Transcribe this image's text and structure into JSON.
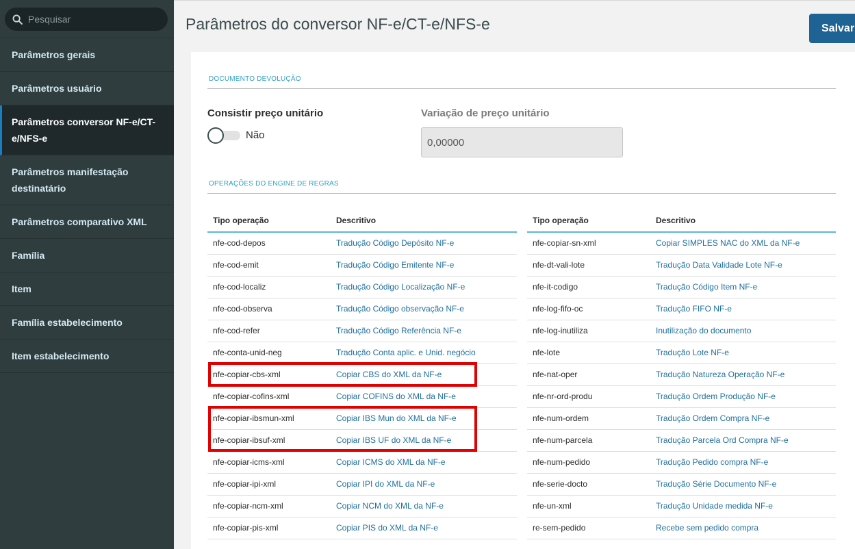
{
  "search": {
    "placeholder": "Pesquisar"
  },
  "sidebar": {
    "items": [
      {
        "label": "Parâmetros gerais"
      },
      {
        "label": "Parâmetros usuário"
      },
      {
        "label": "Parâmetros conversor NF-e/CT-e/NFS-e"
      },
      {
        "label": "Parâmetros manifestação destinatário"
      },
      {
        "label": "Parâmetros comparativo XML"
      },
      {
        "label": "Família"
      },
      {
        "label": "Item"
      },
      {
        "label": "Família estabelecimento"
      },
      {
        "label": "Item estabelecimento"
      }
    ]
  },
  "header": {
    "title": "Parâmetros do conversor NF-e/CT-e/NFS-e",
    "save_label": "Salvar"
  },
  "document_return": {
    "section_title": "DOCUMENTO DEVOLUÇÃO",
    "check_price_label": "Consistir preço unitário",
    "toggle_value": "Não",
    "price_variation_label": "Variação de preço unitário",
    "price_variation_value": "0,00000"
  },
  "operations": {
    "section_title": "OPERAÇÕES DO ENGINE DE REGRAS",
    "headers": {
      "type": "Tipo operação",
      "description": "Descritivo"
    },
    "left_rows": [
      {
        "type": "nfe-cod-depos",
        "description": "Tradução Código Depósito NF-e"
      },
      {
        "type": "nfe-cod-emit",
        "description": "Tradução Código Emitente NF-e"
      },
      {
        "type": "nfe-cod-localiz",
        "description": "Tradução Código Localização NF-e"
      },
      {
        "type": "nfe-cod-observa",
        "description": "Tradução Código observação NF-e"
      },
      {
        "type": "nfe-cod-refer",
        "description": "Tradução Código Referência NF-e"
      },
      {
        "type": "nfe-conta-unid-neg",
        "description": "Tradução Conta aplic. e Unid. negócio"
      },
      {
        "type": "nfe-copiar-cbs-xml",
        "description": "Copiar CBS do XML da NF-e"
      },
      {
        "type": "nfe-copiar-cofins-xml",
        "description": "Copiar COFINS do XML da NF-e"
      },
      {
        "type": "nfe-copiar-ibsmun-xml",
        "description": "Copiar IBS Mun do XML da NF-e"
      },
      {
        "type": "nfe-copiar-ibsuf-xml",
        "description": "Copiar IBS UF do XML da NF-e"
      },
      {
        "type": "nfe-copiar-icms-xml",
        "description": "Copiar ICMS do XML da NF-e"
      },
      {
        "type": "nfe-copiar-ipi-xml",
        "description": "Copiar IPI do XML da NF-e"
      },
      {
        "type": "nfe-copiar-ncm-xml",
        "description": "Copiar NCM do XML da NF-e"
      },
      {
        "type": "nfe-copiar-pis-xml",
        "description": "Copiar PIS do XML da NF-e"
      }
    ],
    "right_rows": [
      {
        "type": "nfe-copiar-sn-xml",
        "description": "Copiar SIMPLES NAC do XML da NF-e"
      },
      {
        "type": "nfe-dt-vali-lote",
        "description": "Tradução Data Validade Lote NF-e"
      },
      {
        "type": "nfe-it-codigo",
        "description": "Tradução Código Item NF-e"
      },
      {
        "type": "nfe-log-fifo-oc",
        "description": "Tradução FIFO NF-e"
      },
      {
        "type": "nfe-log-inutiliza",
        "description": "Inutilização do documento"
      },
      {
        "type": "nfe-lote",
        "description": "Tradução Lote NF-e"
      },
      {
        "type": "nfe-nat-oper",
        "description": "Tradução Natureza Operação NF-e"
      },
      {
        "type": "nfe-nr-ord-produ",
        "description": "Tradução Ordem Produção NF-e"
      },
      {
        "type": "nfe-num-ordem",
        "description": "Tradução Ordem Compra NF-e"
      },
      {
        "type": "nfe-num-parcela",
        "description": "Tradução Parcela Ord Compra NF-e"
      },
      {
        "type": "nfe-num-pedido",
        "description": "Tradução Pedido compra NF-e"
      },
      {
        "type": "nfe-serie-docto",
        "description": "Tradução Série Documento NF-e"
      },
      {
        "type": "nfe-un-xml",
        "description": "Tradução Unidade medida NF-e"
      },
      {
        "type": "re-sem-pedido",
        "description": "Recebe sem pedido compra"
      }
    ]
  },
  "colors": {
    "sidebar_bg": "#2f3d3f",
    "accent": "#1f6294",
    "link": "#1f6f9d",
    "section_title": "#2da0c1",
    "highlight": "#e20000"
  }
}
